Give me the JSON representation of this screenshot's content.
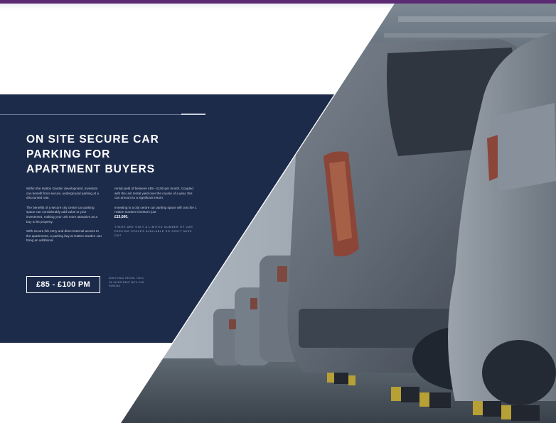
{
  "colors": {
    "top_bar": "#5b2a73",
    "panel": "#1d2b4b",
    "text": "#ffffff"
  },
  "heading": {
    "line1": "ON SITE SECURE CAR",
    "line2": "PARKING FOR",
    "line3": "APARTMENT BUYERS"
  },
  "left_column": {
    "p1": "Within the Hatton Garden development, investors can benefit from secure, underground parking at a discounted rate.",
    "p2": "The benefits of a secure city centre car parking space can considerably add value to your investment, making your unit more attractive as a buy to let property.",
    "p3": "With secure fob entry and direct internal access to the apartments, a parking bay at Hatton Garden can bring an additional"
  },
  "right_column": {
    "p1": "rental yield of between £85 - £100 per month. Coupled with the unit rental yield over the course of a year, this can amount to a significant return.",
    "p2": "Investing in a city centre car parking space will cost the 1 Hatton Garden investors just",
    "price": "£15,000.",
    "notice": "THERE ARE ONLY A LIMITED NUMBER OF CAR PARKING SPACES AVAILABLE SO DON'T MISS OUT."
  },
  "price_box": {
    "label": "£85 - £100 PM",
    "note": "ADDITIONAL RENTAL YIELD ON INVESTMENT WITH CAR PARKING"
  },
  "photo": {
    "subject": "car-park-photo"
  }
}
